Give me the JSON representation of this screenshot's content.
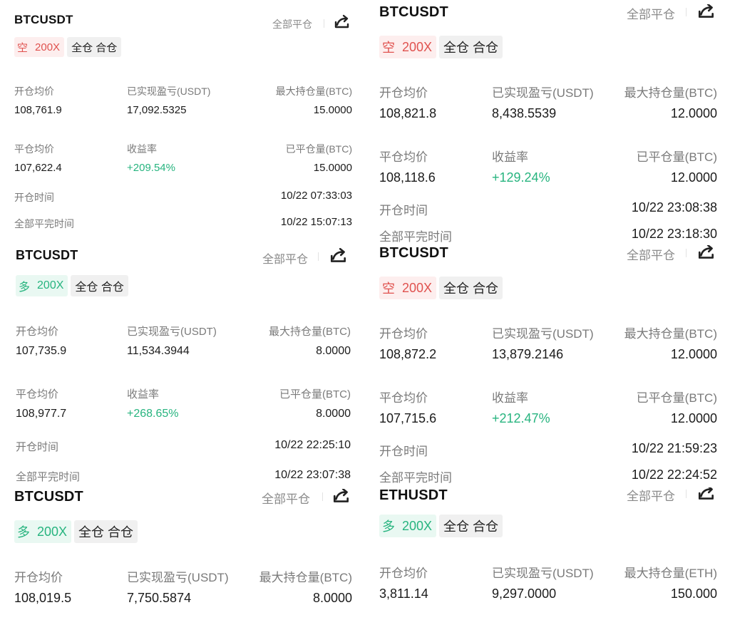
{
  "cards": [
    {
      "symbol": "BTCUSDT",
      "close_all": "全部平仓",
      "side": "空",
      "leverage": "200X",
      "mode": "全仓 合仓",
      "labels": {
        "open_avg": "开仓均价",
        "realized": "已实现盈亏(USDT)",
        "max_pos": "最大持仓量(BTC)",
        "close_avg": "平仓均价",
        "roi": "收益率",
        "closed_qty": "已平仓量(BTC)",
        "open_time": "开仓时间",
        "close_time": "全部平完时间"
      },
      "values": {
        "open_avg": "108,761.9",
        "realized": "17,092.5325",
        "max_pos": "15.0000",
        "close_avg": "107,622.4",
        "roi": "+209.54%",
        "closed_qty": "15.0000",
        "open_time": "10/22 07:33:03",
        "close_time": "10/22 15:07:13"
      }
    },
    {
      "symbol": "BTCUSDT",
      "close_all": "全部平仓",
      "side": "空",
      "leverage": "200X",
      "mode": "全仓 合仓",
      "labels": {
        "open_avg": "开仓均价",
        "realized": "已实现盈亏(USDT)",
        "max_pos": "最大持仓量(BTC)",
        "close_avg": "平仓均价",
        "roi": "收益率",
        "closed_qty": "已平仓量(BTC)",
        "open_time": "开仓时间",
        "close_time": "全部平完时间"
      },
      "values": {
        "open_avg": "108,821.8",
        "realized": "8,438.5539",
        "max_pos": "12.0000",
        "close_avg": "108,118.6",
        "roi": "+129.24%",
        "closed_qty": "12.0000",
        "open_time": "10/22 23:08:38",
        "close_time": "10/22 23:18:30"
      }
    },
    {
      "symbol": "BTCUSDT",
      "close_all": "全部平仓",
      "side": "多",
      "leverage": "200X",
      "mode": "全仓 合仓",
      "labels": {
        "open_avg": "开仓均价",
        "realized": "已实现盈亏(USDT)",
        "max_pos": "最大持仓量(BTC)",
        "close_avg": "平仓均价",
        "roi": "收益率",
        "closed_qty": "已平仓量(BTC)",
        "open_time": "开仓时间",
        "close_time": "全部平完时间"
      },
      "values": {
        "open_avg": "107,735.9",
        "realized": "11,534.3944",
        "max_pos": "8.0000",
        "close_avg": "108,977.7",
        "roi": "+268.65%",
        "closed_qty": "8.0000",
        "open_time": "10/22 22:25:10",
        "close_time": "10/22 23:07:38"
      }
    },
    {
      "symbol": "BTCUSDT",
      "close_all": "全部平仓",
      "side": "空",
      "leverage": "200X",
      "mode": "全仓 合仓",
      "labels": {
        "open_avg": "开仓均价",
        "realized": "已实现盈亏(USDT)",
        "max_pos": "最大持仓量(BTC)",
        "close_avg": "平仓均价",
        "roi": "收益率",
        "closed_qty": "已平仓量(BTC)",
        "open_time": "开仓时间",
        "close_time": "全部平完时间"
      },
      "values": {
        "open_avg": "108,872.2",
        "realized": "13,879.2146",
        "max_pos": "12.0000",
        "close_avg": "107,715.6",
        "roi": "+212.47%",
        "closed_qty": "12.0000",
        "open_time": "10/22 21:59:23",
        "close_time": "10/22 22:24:52"
      }
    },
    {
      "symbol": "BTCUSDT",
      "close_all": "全部平仓",
      "side": "多",
      "leverage": "200X",
      "mode": "全仓 合仓",
      "labels": {
        "open_avg": "开仓均价",
        "realized": "已实现盈亏(USDT)",
        "max_pos": "最大持仓量(BTC)"
      },
      "values": {
        "open_avg": "108,019.5",
        "realized": "7,750.5874",
        "max_pos": "8.0000"
      }
    },
    {
      "symbol": "ETHUSDT",
      "close_all": "全部平仓",
      "side": "多",
      "leverage": "200X",
      "mode": "全仓 合仓",
      "labels": {
        "open_avg": "开仓均价",
        "realized": "已实现盈亏(USDT)",
        "max_pos": "最大持仓量(ETH)"
      },
      "values": {
        "open_avg": "3,811.14",
        "realized": "9,297.0000",
        "max_pos": "150.000"
      }
    }
  ],
  "colors": {
    "short": "#e0524f",
    "long": "#27b47f",
    "roi": "#27b47f"
  },
  "icons": {
    "share": "share-icon"
  }
}
